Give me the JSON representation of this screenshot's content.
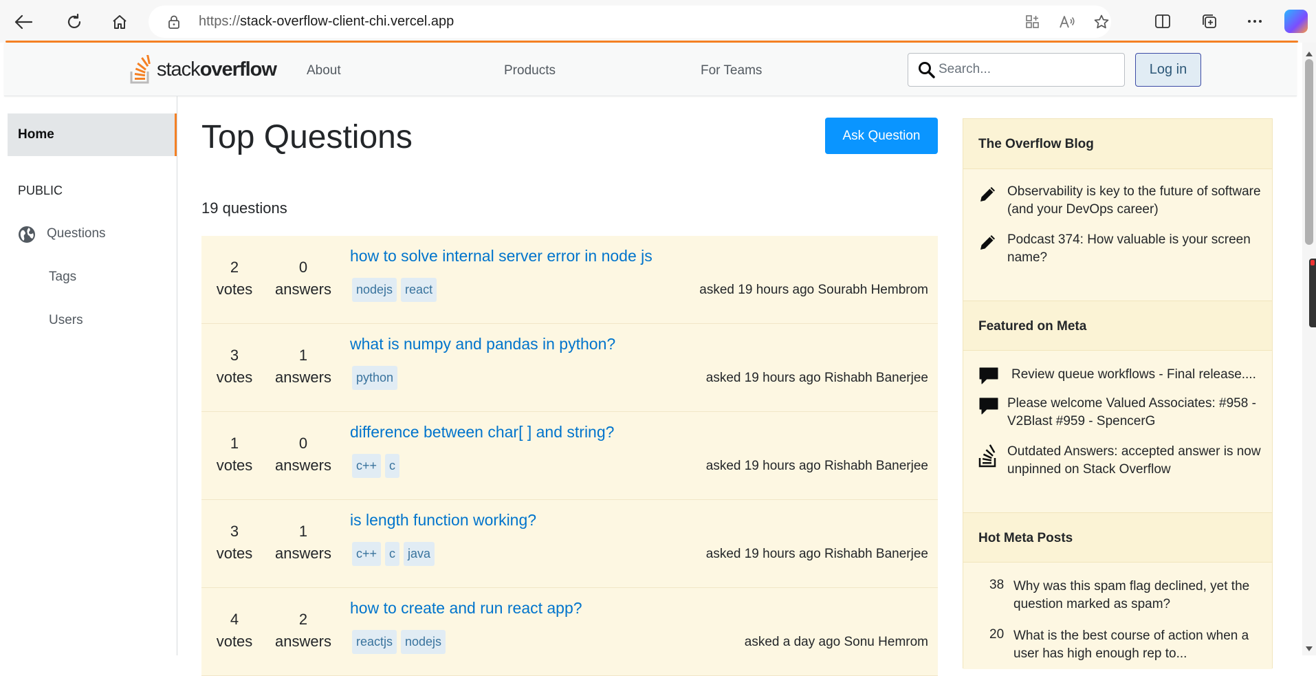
{
  "browser": {
    "url_protocol": "https://",
    "url_host": "stack-overflow-client-chi.vercel.app"
  },
  "header": {
    "logo_text_light": "stack",
    "logo_text_bold": "overflow",
    "nav": [
      "About",
      "Products",
      "For Teams"
    ],
    "search_placeholder": "Search...",
    "login_label": "Log in"
  },
  "sidebar": {
    "home": "Home",
    "section": "PUBLIC",
    "items": [
      "Questions",
      "Tags",
      "Users"
    ]
  },
  "main": {
    "title": "Top Questions",
    "ask_button": "Ask Question",
    "count_text": "19 questions",
    "questions": [
      {
        "votes": "2",
        "votes_label": "votes",
        "answers": "0",
        "answers_label": "answers",
        "title": "how to solve internal server error in node js",
        "tags": [
          "nodejs",
          "react"
        ],
        "asked": "asked 19 hours ago Sourabh Hembrom"
      },
      {
        "votes": "3",
        "votes_label": "votes",
        "answers": "1",
        "answers_label": "answers",
        "title": "what is numpy and pandas in python?",
        "tags": [
          "python"
        ],
        "asked": "asked 19 hours ago Rishabh Banerjee"
      },
      {
        "votes": "1",
        "votes_label": "votes",
        "answers": "0",
        "answers_label": "answers",
        "title": "difference between char[ ] and string?",
        "tags": [
          "c++",
          "c"
        ],
        "asked": "asked 19 hours ago Rishabh Banerjee"
      },
      {
        "votes": "3",
        "votes_label": "votes",
        "answers": "1",
        "answers_label": "answers",
        "title": "is length function working?",
        "tags": [
          "c++",
          "c",
          "java"
        ],
        "asked": "asked 19 hours ago Rishabh Banerjee"
      },
      {
        "votes": "4",
        "votes_label": "votes",
        "answers": "2",
        "answers_label": "answers",
        "title": "how to create and run react app?",
        "tags": [
          "reactjs",
          "nodejs"
        ],
        "asked": "asked a day ago Sonu Hemrom"
      }
    ]
  },
  "right": {
    "blog_title": "The Overflow Blog",
    "blog_items": [
      {
        "icon": "pencil-icon",
        "text": "Observability is key to the future of software (and your DevOps career)"
      },
      {
        "icon": "pencil-icon",
        "text": "Podcast 374: How valuable is your screen name?"
      }
    ],
    "meta_title": "Featured on Meta",
    "meta_items": [
      {
        "icon": "comment-icon",
        "text": "Review queue workflows - Final release...."
      },
      {
        "icon": "comment-icon",
        "text": "Please welcome Valued Associates: #958 - V2Blast #959 - SpencerG"
      },
      {
        "icon": "stack-overflow-icon",
        "text": "Outdated Answers: accepted answer is now unpinned on Stack Overflow"
      }
    ],
    "hot_title": "Hot Meta Posts",
    "hot_items": [
      {
        "count": "38",
        "text": "Why was this spam flag declined, yet the question marked as spam?"
      },
      {
        "count": "20",
        "text": "What is the best course of action when a user has high enough rep to..."
      }
    ]
  },
  "colors": {
    "accent": "#f48024",
    "link": "#0074cc",
    "primary_button": "#0a95ff",
    "question_bg": "#fdf7e2",
    "panel_bg": "#fbf3d5"
  }
}
